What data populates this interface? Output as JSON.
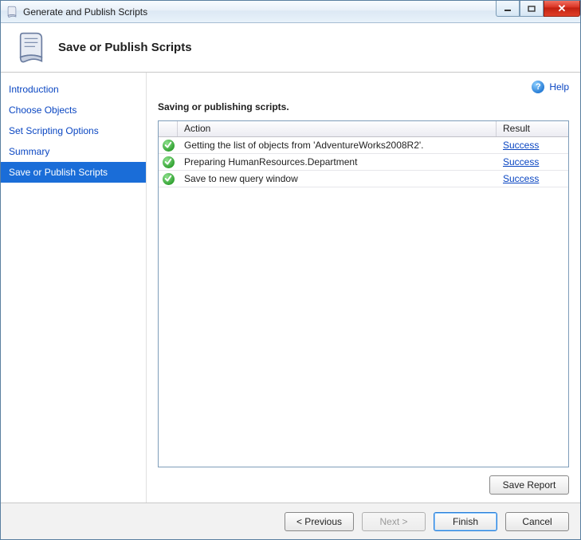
{
  "window": {
    "title": "Generate and Publish Scripts"
  },
  "header": {
    "title": "Save or Publish Scripts"
  },
  "help": {
    "label": "Help"
  },
  "sidebar": {
    "items": [
      {
        "label": "Introduction",
        "selected": false
      },
      {
        "label": "Choose Objects",
        "selected": false
      },
      {
        "label": "Set Scripting Options",
        "selected": false
      },
      {
        "label": "Summary",
        "selected": false
      },
      {
        "label": "Save or Publish Scripts",
        "selected": true
      }
    ]
  },
  "main": {
    "subheading": "Saving or publishing scripts.",
    "columns": {
      "action": "Action",
      "result": "Result"
    },
    "rows": [
      {
        "status": "success",
        "action": "Getting the list of objects from 'AdventureWorks2008R2'.",
        "result": "Success"
      },
      {
        "status": "success",
        "action": "Preparing HumanResources.Department",
        "result": "Success"
      },
      {
        "status": "success",
        "action": "Save to new query window",
        "result": "Success"
      }
    ],
    "save_report_label": "Save Report"
  },
  "footer": {
    "previous": "< Previous",
    "next": "Next >",
    "finish": "Finish",
    "cancel": "Cancel",
    "next_enabled": false
  }
}
